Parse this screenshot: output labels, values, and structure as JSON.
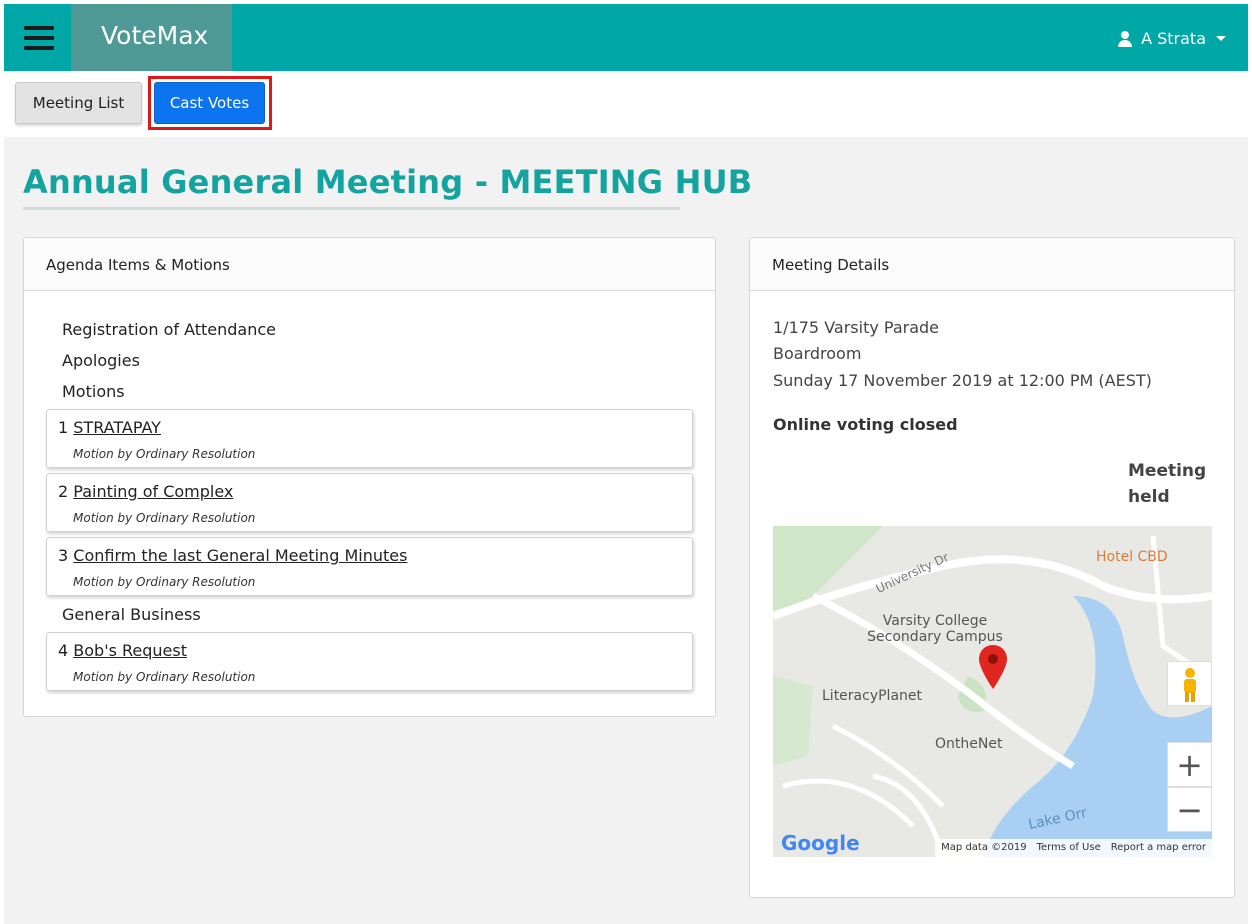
{
  "app": {
    "brand": "VoteMax",
    "user": "A Strata"
  },
  "toolbar": {
    "meeting_list": "Meeting List",
    "cast_votes": "Cast Votes"
  },
  "page": {
    "title": "Annual General Meeting - MEETING HUB"
  },
  "agenda": {
    "header": "Agenda Items & Motions",
    "items": [
      "Registration of Attendance",
      "Apologies",
      "Motions"
    ],
    "motions": [
      {
        "num": "1",
        "title": "STRATAPAY",
        "type": "Motion by Ordinary Resolution"
      },
      {
        "num": "2",
        "title": "Painting of Complex",
        "type": "Motion by Ordinary Resolution"
      },
      {
        "num": "3",
        "title": "Confirm the last General Meeting Minutes",
        "type": "Motion by Ordinary Resolution"
      }
    ],
    "general_business": "General Business",
    "general_motions": [
      {
        "num": "4",
        "title": "Bob's Request",
        "type": "Motion by Ordinary Resolution"
      }
    ]
  },
  "details": {
    "header": "Meeting Details",
    "address": "1/175 Varsity Parade",
    "room": "Boardroom",
    "datetime": "Sunday 17 November 2019 at 12:00 PM (AEST)",
    "voting_status": "Online voting closed",
    "meeting_status": "Meeting held"
  },
  "map": {
    "labels": {
      "hotel": "Hotel CBD",
      "college": "Varsity College Secondary Campus",
      "literacy": "LiteracyPlanet",
      "onthenet": "OntheNet",
      "lake": "Lake Orr",
      "university_dr": "University Dr"
    },
    "zoom_in": "+",
    "zoom_out": "−",
    "footer": [
      "Map data ©2019",
      "Terms of Use",
      "Report a map error"
    ],
    "logo": "Google"
  },
  "colors": {
    "teal": "#00a7a7",
    "title": "#15a3a0",
    "primary": "#0d74f0",
    "highlight": "#e01818"
  }
}
